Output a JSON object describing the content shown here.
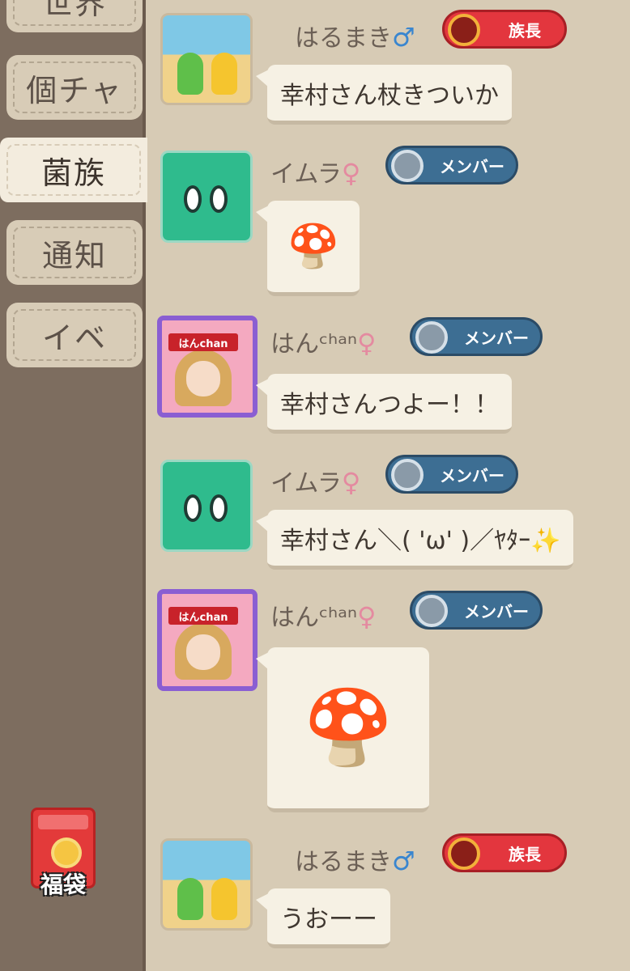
{
  "sidebar": {
    "tabs": [
      {
        "label": "世界"
      },
      {
        "label": "個チャ"
      },
      {
        "label": "菌族"
      },
      {
        "label": "通知"
      },
      {
        "label": "イベ"
      }
    ],
    "active_tab": "菌族",
    "fukubukuro_label": "福袋"
  },
  "messages": [
    {
      "user": "はるまき",
      "gender": "♂",
      "role": "族長",
      "text": "幸村さん杖きついか",
      "avatar": "beach-avatar"
    },
    {
      "user": "イムラ",
      "gender": "♀",
      "role": "メンバー",
      "text": "🍄",
      "avatar": "green-monster-avatar",
      "type": "sticker"
    },
    {
      "user": "はんᶜʰᵃⁿ",
      "gender": "♀",
      "role": "メンバー",
      "text": "幸村さんつよー！！",
      "avatar": "hanchan-avatar",
      "avatar_ribbon": "はんchan"
    },
    {
      "user": "イムラ",
      "gender": "♀",
      "role": "メンバー",
      "text": "幸村さん＼( 'ω' )／ﾔﾀｰ✨",
      "avatar": "green-monster-avatar"
    },
    {
      "user": "はんᶜʰᵃⁿ",
      "gender": "♀",
      "role": "メンバー",
      "text": "🍄",
      "avatar": "hanchan-avatar",
      "avatar_ribbon": "はんchan",
      "type": "sticker"
    },
    {
      "user": "はるまき",
      "gender": "♂",
      "role": "族長",
      "text": "うおーー",
      "avatar": "beach-avatar"
    }
  ],
  "colors": {
    "background": "#d7cbb5",
    "sidebar": "#7d6d5f",
    "leader_badge": "#e3363e",
    "member_badge": "#3d6e93",
    "male": "#3a86cf",
    "female": "#e48aa0"
  }
}
